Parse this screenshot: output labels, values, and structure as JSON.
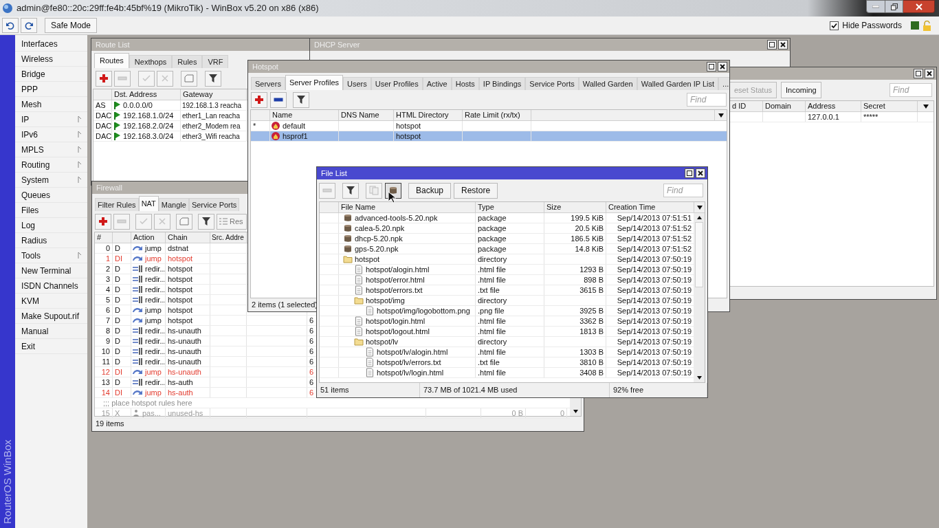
{
  "window": {
    "title": "admin@fe80::20c:29ff:fe4b:45bf%19 (MikroTik) - WinBox v5.20 on x86 (x86)"
  },
  "toolbar": {
    "safe_mode": "Safe Mode",
    "hide_passwords": {
      "label": "Hide Passwords",
      "checked": true
    }
  },
  "side_banner": "RouterOS WinBox",
  "sidebar": {
    "items": [
      {
        "label": "Interfaces",
        "submenu": false
      },
      {
        "label": "Wireless",
        "submenu": false
      },
      {
        "label": "Bridge",
        "submenu": false
      },
      {
        "label": "PPP",
        "submenu": false
      },
      {
        "label": "Mesh",
        "submenu": false
      },
      {
        "label": "IP",
        "submenu": true
      },
      {
        "label": "IPv6",
        "submenu": true
      },
      {
        "label": "MPLS",
        "submenu": true
      },
      {
        "label": "Routing",
        "submenu": true
      },
      {
        "label": "System",
        "submenu": true
      },
      {
        "label": "Queues",
        "submenu": false
      },
      {
        "label": "Files",
        "submenu": false
      },
      {
        "label": "Log",
        "submenu": false
      },
      {
        "label": "Radius",
        "submenu": false
      },
      {
        "label": "Tools",
        "submenu": true
      },
      {
        "label": "New Terminal",
        "submenu": false
      },
      {
        "label": "ISDN Channels",
        "submenu": false
      },
      {
        "label": "KVM",
        "submenu": false
      },
      {
        "label": "Make Supout.rif",
        "submenu": false
      },
      {
        "label": "Manual",
        "submenu": false
      },
      {
        "label": "Exit",
        "submenu": false
      }
    ]
  },
  "route_list": {
    "title": "Route List",
    "active": false,
    "tabs": [
      {
        "label": "Routes",
        "selected": true
      },
      {
        "label": "Nexthops",
        "selected": false
      },
      {
        "label": "Rules",
        "selected": false
      },
      {
        "label": "VRF",
        "selected": false
      }
    ],
    "columns": [
      "Dst. Address",
      "Gateway"
    ],
    "rows": [
      {
        "flags": "AS",
        "dst_address": "0.0.0.0/0",
        "gateway": "192.168.1.3 reacha"
      },
      {
        "flags": "DAC",
        "dst_address": "192.168.1.0/24",
        "gateway": "ether1_Lan reacha"
      },
      {
        "flags": "DAC",
        "dst_address": "192.168.2.0/24",
        "gateway": "ether2_Modem rea"
      },
      {
        "flags": "DAC",
        "dst_address": "192.168.3.0/24",
        "gateway": "ether3_Wifi reacha"
      }
    ]
  },
  "dhcp_server": {
    "title": "DHCP Server",
    "active": false
  },
  "firewall": {
    "title": "Firewall",
    "active": false,
    "tabs": [
      {
        "label": "Filter Rules",
        "selected": false
      },
      {
        "label": "NAT",
        "selected": true
      },
      {
        "label": "Mangle",
        "selected": false
      },
      {
        "label": "Service Ports",
        "selected": false
      }
    ],
    "reset_button": "Res",
    "columns": [
      "#",
      "Action",
      "Chain",
      "Src. Addre"
    ],
    "rows": [
      {
        "kind": "rule",
        "number": "0",
        "flags": "D",
        "action": {
          "kind": "jump",
          "label": "jump"
        },
        "chain": "dstnat",
        "invalid": false,
        "disabled": false
      },
      {
        "kind": "rule",
        "number": "1",
        "flags": "DI",
        "action": {
          "kind": "jump",
          "label": "jump"
        },
        "chain": "hotspot",
        "invalid": true,
        "disabled": false
      },
      {
        "kind": "rule",
        "number": "2",
        "flags": "D",
        "action": {
          "kind": "redirect",
          "label": "redir..."
        },
        "chain": "hotspot",
        "invalid": false,
        "disabled": false
      },
      {
        "kind": "rule",
        "number": "3",
        "flags": "D",
        "action": {
          "kind": "redirect",
          "label": "redir..."
        },
        "chain": "hotspot",
        "invalid": false,
        "disabled": false
      },
      {
        "kind": "rule",
        "number": "4",
        "flags": "D",
        "action": {
          "kind": "redirect",
          "label": "redir..."
        },
        "chain": "hotspot",
        "invalid": false,
        "disabled": false
      },
      {
        "kind": "rule",
        "number": "5",
        "flags": "D",
        "action": {
          "kind": "redirect",
          "label": "redir..."
        },
        "chain": "hotspot",
        "invalid": false,
        "disabled": false
      },
      {
        "kind": "rule",
        "number": "6",
        "flags": "D",
        "action": {
          "kind": "jump",
          "label": "jump"
        },
        "chain": "hotspot",
        "invalid": false,
        "disabled": false
      },
      {
        "kind": "rule",
        "number": "7",
        "flags": "D",
        "action": {
          "kind": "jump",
          "label": "jump"
        },
        "chain": "hotspot",
        "invalid": false,
        "disabled": false,
        "column_7": "6"
      },
      {
        "kind": "rule",
        "number": "8",
        "flags": "D",
        "action": {
          "kind": "redirect",
          "label": "redir..."
        },
        "chain": "hs-unauth",
        "invalid": false,
        "disabled": false,
        "column_7": "6"
      },
      {
        "kind": "rule",
        "number": "9",
        "flags": "D",
        "action": {
          "kind": "redirect",
          "label": "redir..."
        },
        "chain": "hs-unauth",
        "invalid": false,
        "disabled": false,
        "column_7": "6"
      },
      {
        "kind": "rule",
        "number": "10",
        "flags": "D",
        "action": {
          "kind": "redirect",
          "label": "redir..."
        },
        "chain": "hs-unauth",
        "invalid": false,
        "disabled": false,
        "column_7": "6"
      },
      {
        "kind": "rule",
        "number": "11",
        "flags": "D",
        "action": {
          "kind": "redirect",
          "label": "redir..."
        },
        "chain": "hs-unauth",
        "invalid": false,
        "disabled": false,
        "column_7": "6"
      },
      {
        "kind": "rule",
        "number": "12",
        "flags": "DI",
        "action": {
          "kind": "jump",
          "label": "jump"
        },
        "chain": "hs-unauth",
        "invalid": true,
        "disabled": false,
        "column_7": "6"
      },
      {
        "kind": "rule",
        "number": "13",
        "flags": "D",
        "action": {
          "kind": "redirect",
          "label": "redir..."
        },
        "chain": "hs-auth",
        "invalid": false,
        "disabled": false,
        "column_7": "6"
      },
      {
        "kind": "rule",
        "number": "14",
        "flags": "DI",
        "action": {
          "kind": "jump",
          "label": "jump"
        },
        "chain": "hs-auth",
        "invalid": true,
        "disabled": false,
        "column_7": "6"
      },
      {
        "kind": "comment",
        "text": ";;; place hotspot rules here"
      },
      {
        "kind": "rule",
        "number": "15",
        "flags": "X",
        "action": {
          "kind": "passthrough",
          "label": "pas..."
        },
        "chain": "unused-hs",
        "invalid": false,
        "disabled": true,
        "column_9": "0 B",
        "column_10": "0"
      }
    ],
    "status": "19 items"
  },
  "hotspot": {
    "title": "Hotspot",
    "active": false,
    "tabs": [
      {
        "label": "Servers",
        "selected": false
      },
      {
        "label": "Server Profiles",
        "selected": true
      },
      {
        "label": "Users",
        "selected": false
      },
      {
        "label": "User Profiles",
        "selected": false
      },
      {
        "label": "Active",
        "selected": false
      },
      {
        "label": "Hosts",
        "selected": false
      },
      {
        "label": "IP Bindings",
        "selected": false
      },
      {
        "label": "Service Ports",
        "selected": false
      },
      {
        "label": "Walled Garden",
        "selected": false
      },
      {
        "label": "Walled Garden IP List",
        "selected": false
      },
      {
        "label": "...",
        "selected": false
      }
    ],
    "search": {
      "placeholder": "Find"
    },
    "columns": [
      "Name",
      "DNS Name",
      "HTML Directory",
      "Rate Limit (rx/tx)"
    ],
    "rows": [
      {
        "flag": "*",
        "name": "default",
        "html_directory": "hotspot",
        "selected": false
      },
      {
        "name": "hsprof1",
        "html_directory": "hotspot",
        "selected": true
      }
    ],
    "status": "2 items (1 selected)"
  },
  "right_window": {
    "active": false,
    "buttons": [
      {
        "label": "eset Status",
        "disabled": true
      },
      {
        "label": "Incoming",
        "disabled": false
      }
    ],
    "search": {
      "placeholder": "Find"
    },
    "columns": [
      "d ID",
      "Domain",
      "Address",
      "Secret"
    ],
    "rows": [
      {
        "address": "127.0.0.1",
        "secret": "*****"
      }
    ]
  },
  "file_list": {
    "title": "File List",
    "active": true,
    "buttons": [
      "Backup",
      "Restore"
    ],
    "search": {
      "placeholder": "Find"
    },
    "columns": [
      "File Name",
      "Type",
      "Size",
      "Creation Time"
    ],
    "rows": [
      {
        "kind": "package",
        "name": "advanced-tools-5.20.npk",
        "type": "package",
        "size": "199.5 KiB",
        "created": "Sep/14/2013 07:51:51"
      },
      {
        "kind": "package",
        "name": "calea-5.20.npk",
        "type": "package",
        "size": "20.5 KiB",
        "created": "Sep/14/2013 07:51:52"
      },
      {
        "kind": "package",
        "name": "dhcp-5.20.npk",
        "type": "package",
        "size": "186.5 KiB",
        "created": "Sep/14/2013 07:51:52"
      },
      {
        "kind": "package",
        "name": "gps-5.20.npk",
        "type": "package",
        "size": "14.8 KiB",
        "created": "Sep/14/2013 07:51:52"
      },
      {
        "kind": "directory",
        "name": "hotspot",
        "type": "directory",
        "created": "Sep/14/2013 07:50:19",
        "children": [
          {
            "kind": "file",
            "name": "hotspot/alogin.html",
            "type": ".html file",
            "size": "1293 B",
            "created": "Sep/14/2013 07:50:19"
          },
          {
            "kind": "file",
            "name": "hotspot/error.html",
            "type": ".html file",
            "size": "898 B",
            "created": "Sep/14/2013 07:50:19"
          },
          {
            "kind": "file",
            "name": "hotspot/errors.txt",
            "type": ".txt file",
            "size": "3615 B",
            "created": "Sep/14/2013 07:50:19"
          },
          {
            "kind": "directory",
            "name": "hotspot/img",
            "type": "directory",
            "created": "Sep/14/2013 07:50:19",
            "children": [
              {
                "kind": "file",
                "name": "hotspot/img/logobottom.png",
                "type": ".png file",
                "size": "3925 B",
                "created": "Sep/14/2013 07:50:19"
              }
            ]
          },
          {
            "kind": "file",
            "name": "hotspot/login.html",
            "type": ".html file",
            "size": "3362 B",
            "created": "Sep/14/2013 07:50:19"
          },
          {
            "kind": "file",
            "name": "hotspot/logout.html",
            "type": ".html file",
            "size": "1813 B",
            "created": "Sep/14/2013 07:50:19"
          },
          {
            "kind": "directory",
            "name": "hotspot/lv",
            "type": "directory",
            "created": "Sep/14/2013 07:50:19",
            "children": [
              {
                "kind": "file",
                "name": "hotspot/lv/alogin.html",
                "type": ".html file",
                "size": "1303 B",
                "created": "Sep/14/2013 07:50:19"
              },
              {
                "kind": "file",
                "name": "hotspot/lv/errors.txt",
                "type": ".txt file",
                "size": "3810 B",
                "created": "Sep/14/2013 07:50:19"
              },
              {
                "kind": "file",
                "name": "hotspot/lv/login.html",
                "type": ".html file",
                "size": "3408 B",
                "created": "Sep/14/2013 07:50:19"
              }
            ]
          }
        ]
      }
    ],
    "status": [
      "51 items",
      "73.7 MB of 1021.4 MB used",
      "92% free"
    ]
  }
}
